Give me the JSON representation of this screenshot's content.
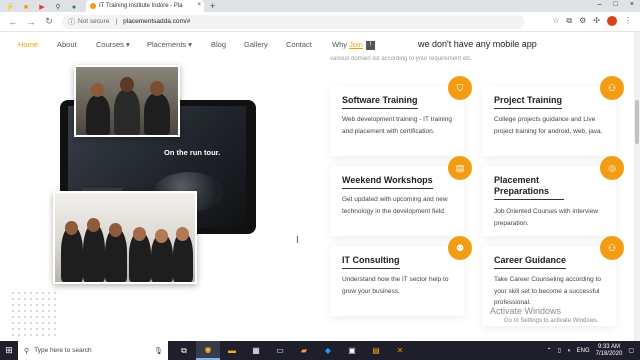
{
  "browser": {
    "tab_title": "IT Training Institute Indore - Pla",
    "tab_close": "×",
    "new_tab": "+",
    "address_status": "Not secure",
    "address_separator": "|",
    "url": "placementsadda.com/#",
    "window_controls": [
      "–",
      "□",
      "×"
    ],
    "bookmark_icons": [
      "lightning-icon",
      "bookmark-orange-icon",
      "youtube-icon",
      "search-icon",
      "green-icon"
    ]
  },
  "nav": {
    "home": "Home",
    "about": "About",
    "courses": "Courses",
    "placements": "Placements",
    "blog": "Blog",
    "gallery": "Gallery",
    "contact": "Contact",
    "why": "Why",
    "join": "Join",
    "dropdown_caret": "▾",
    "mobile_message": "we don't have any mobile app"
  },
  "page": {
    "faded_text": "various domain list according to your requirement etc.",
    "tablet_text": "On the run tour."
  },
  "cards": [
    {
      "title": "Software Training",
      "desc": "Web development training - IT training and placement with certification.",
      "icon": "shield-icon",
      "glyph": "⛉"
    },
    {
      "title": "Project Training",
      "desc": "College projects guidance and Live project training for android, web, java.",
      "icon": "user-icon",
      "glyph": "⚇"
    },
    {
      "title": "Weekend Workshops",
      "desc": "Get updated with upcoming and new technology in the development field.",
      "icon": "document-icon",
      "glyph": "▤"
    },
    {
      "title": "Placement Preparations",
      "desc": "Job Oriented Courses with interview preparation.",
      "icon": "coin-icon",
      "glyph": "◎"
    },
    {
      "title": "IT Consulting",
      "desc": "Understand how the IT sector help to grow your business.",
      "icon": "people-icon",
      "glyph": "⚉"
    },
    {
      "title": "Career Guidance",
      "desc": "Take Career Counseling according to your skill set to become a successful professional.",
      "icon": "user-check-icon",
      "glyph": "⚇"
    }
  ],
  "watermark": {
    "title": "Activate Windows",
    "subtitle": "Go to Settings to activate Windows."
  },
  "taskbar": {
    "search_placeholder": "Type here to search",
    "language": "ENG",
    "time": "9:33 AM",
    "date": "7/18/2020",
    "apps": [
      "task-view-icon",
      "chrome-icon",
      "file-explorer-icon",
      "calculator-icon",
      "terminal-icon",
      "folder-icon",
      "vscode-icon",
      "monitor-icon",
      "files-icon",
      "xampp-icon"
    ]
  },
  "colors": {
    "accent": "#f39c12",
    "taskbar": "#1f1f2b"
  }
}
